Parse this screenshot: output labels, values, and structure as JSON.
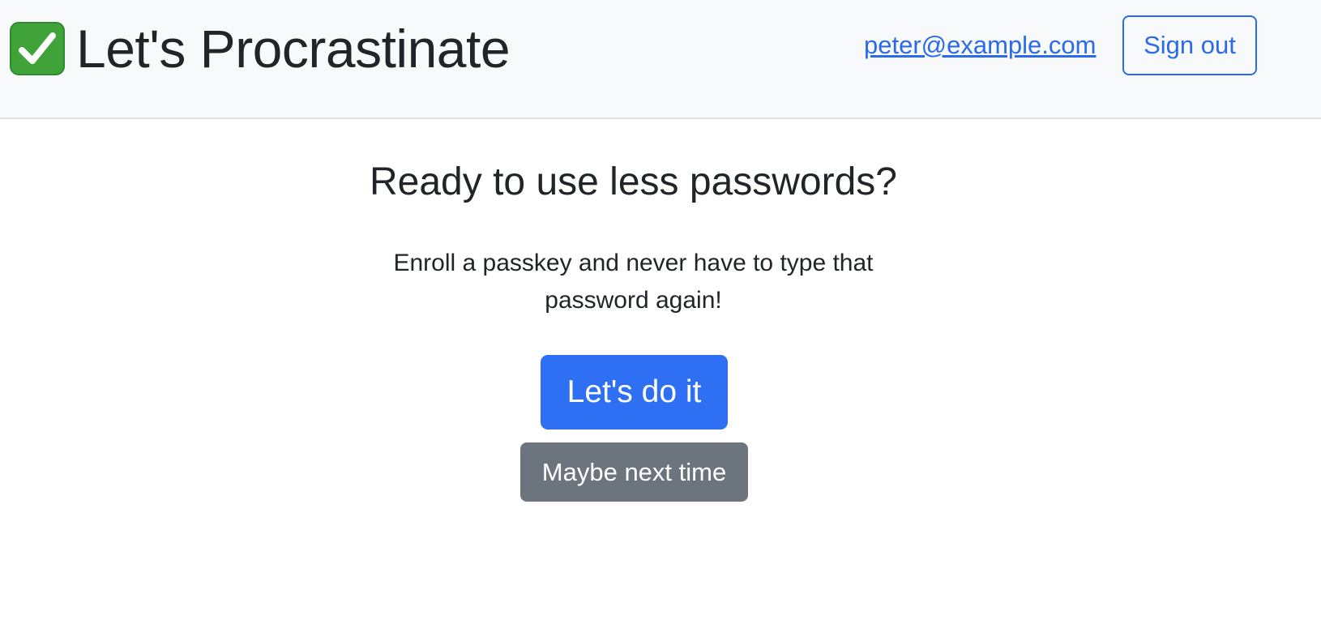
{
  "header": {
    "brand_icon": "check-mark-icon",
    "brand_title": "Let's Procrastinate",
    "user_email": "peter@example.com",
    "sign_out_label": "Sign out"
  },
  "main": {
    "heading": "Ready to use less passwords?",
    "description": "Enroll a passkey and never have to type that password again!",
    "primary_button_label": "Let's do it",
    "secondary_button_label": "Maybe next time"
  },
  "colors": {
    "primary": "#2f6ff3",
    "secondary": "#6c757d",
    "navbar_bg": "#f8f9fa",
    "link": "#2b6be8",
    "check_green": "#3fa33a"
  }
}
